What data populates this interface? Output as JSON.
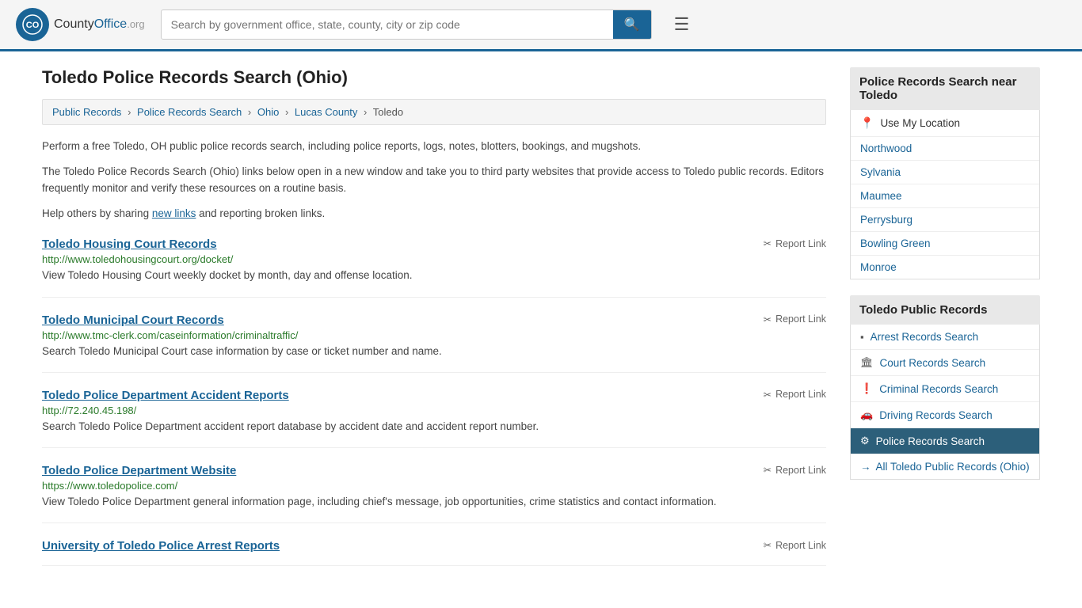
{
  "header": {
    "logo_text": "CountyOffice",
    "logo_org": ".org",
    "search_placeholder": "Search by government office, state, county, city or zip code",
    "search_value": ""
  },
  "page": {
    "title": "Toledo Police Records Search (Ohio)"
  },
  "breadcrumb": {
    "items": [
      {
        "label": "Public Records",
        "href": "#"
      },
      {
        "label": "Police Records Search",
        "href": "#"
      },
      {
        "label": "Ohio",
        "href": "#"
      },
      {
        "label": "Lucas County",
        "href": "#"
      },
      {
        "label": "Toledo",
        "href": "#"
      }
    ]
  },
  "description": {
    "para1": "Perform a free Toledo, OH public police records search, including police reports, logs, notes, blotters, bookings, and mugshots.",
    "para2": "The Toledo Police Records Search (Ohio) links below open in a new window and take you to third party websites that provide access to Toledo public records. Editors frequently monitor and verify these resources on a routine basis.",
    "para3_prefix": "Help others by sharing ",
    "para3_link": "new links",
    "para3_suffix": " and reporting broken links."
  },
  "records": [
    {
      "title": "Toledo Housing Court Records",
      "url": "http://www.toledohousingcourt.org/docket/",
      "description": "View Toledo Housing Court weekly docket by month, day and offense location.",
      "report_label": "Report Link"
    },
    {
      "title": "Toledo Municipal Court Records",
      "url": "http://www.tmc-clerk.com/caseinformation/criminaltraffic/",
      "description": "Search Toledo Municipal Court case information by case or ticket number and name.",
      "report_label": "Report Link"
    },
    {
      "title": "Toledo Police Department Accident Reports",
      "url": "http://72.240.45.198/",
      "description": "Search Toledo Police Department accident report database by accident date and accident report number.",
      "report_label": "Report Link"
    },
    {
      "title": "Toledo Police Department Website",
      "url": "https://www.toledopolice.com/",
      "description": "View Toledo Police Department general information page, including chief's message, job opportunities, crime statistics and contact information.",
      "report_label": "Report Link"
    },
    {
      "title": "University of Toledo Police Arrest Reports",
      "url": "",
      "description": "",
      "report_label": "Report Link"
    }
  ],
  "sidebar": {
    "nearby_header": "Police Records Search near Toledo",
    "use_location_label": "Use My Location",
    "nearby_cities": [
      "Northwood",
      "Sylvania",
      "Maumee",
      "Perrysburg",
      "Bowling Green",
      "Monroe"
    ],
    "public_records_header": "Toledo Public Records",
    "public_records_items": [
      {
        "label": "Arrest Records Search",
        "icon": "▪",
        "active": false
      },
      {
        "label": "Court Records Search",
        "icon": "🏛",
        "active": false
      },
      {
        "label": "Criminal Records Search",
        "icon": "❗",
        "active": false
      },
      {
        "label": "Driving Records Search",
        "icon": "🚗",
        "active": false
      },
      {
        "label": "Police Records Search",
        "icon": "⚙",
        "active": true
      }
    ],
    "all_records_label": "All Toledo Public Records (Ohio)"
  }
}
